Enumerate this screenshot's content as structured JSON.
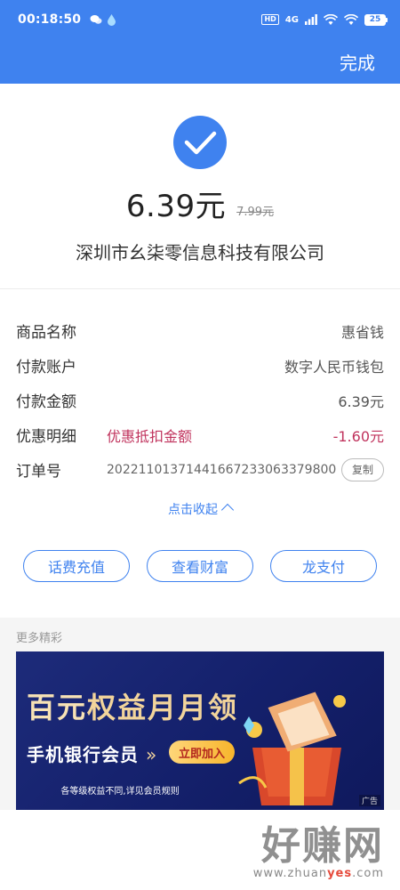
{
  "status_bar": {
    "time": "00:18:50",
    "network": "4G",
    "hd": "HD",
    "battery": "25"
  },
  "nav": {
    "done_label": "完成"
  },
  "payment": {
    "amount": "6.39元",
    "original_amount": "7.99元",
    "merchant": "深圳市幺柒零信息科技有限公司"
  },
  "details": {
    "product_label": "商品名称",
    "product_value": "惠省钱",
    "account_label": "付款账户",
    "account_value": "数字人民币钱包",
    "pay_amount_label": "付款金额",
    "pay_amount_value": "6.39元",
    "discount_label": "优惠明细",
    "discount_name": "优惠抵扣金额",
    "discount_value": "-1.60元",
    "order_label": "订单号",
    "order_value": "2022110137144166723306337980​0",
    "copy_label": "复制"
  },
  "collapse_label": "点击收起",
  "actions": [
    "话费充值",
    "查看财富",
    "龙支付"
  ],
  "more": {
    "title": "更多精彩"
  },
  "banner": {
    "title_part1": "百元",
    "title_part2": "权益月月领",
    "subtitle": "手机银行会员",
    "arrow": "»",
    "join_label": "立即加入",
    "note": "各等级权益不同,详见会员规则",
    "ad_tag": "广告"
  },
  "watermark": {
    "main": "好赚网",
    "url_part1": "www.zhuan",
    "url_highlight": "yes",
    "url_part2": ".com"
  },
  "colors": {
    "primary": "#3f82ef",
    "discount": "#c0335d"
  }
}
